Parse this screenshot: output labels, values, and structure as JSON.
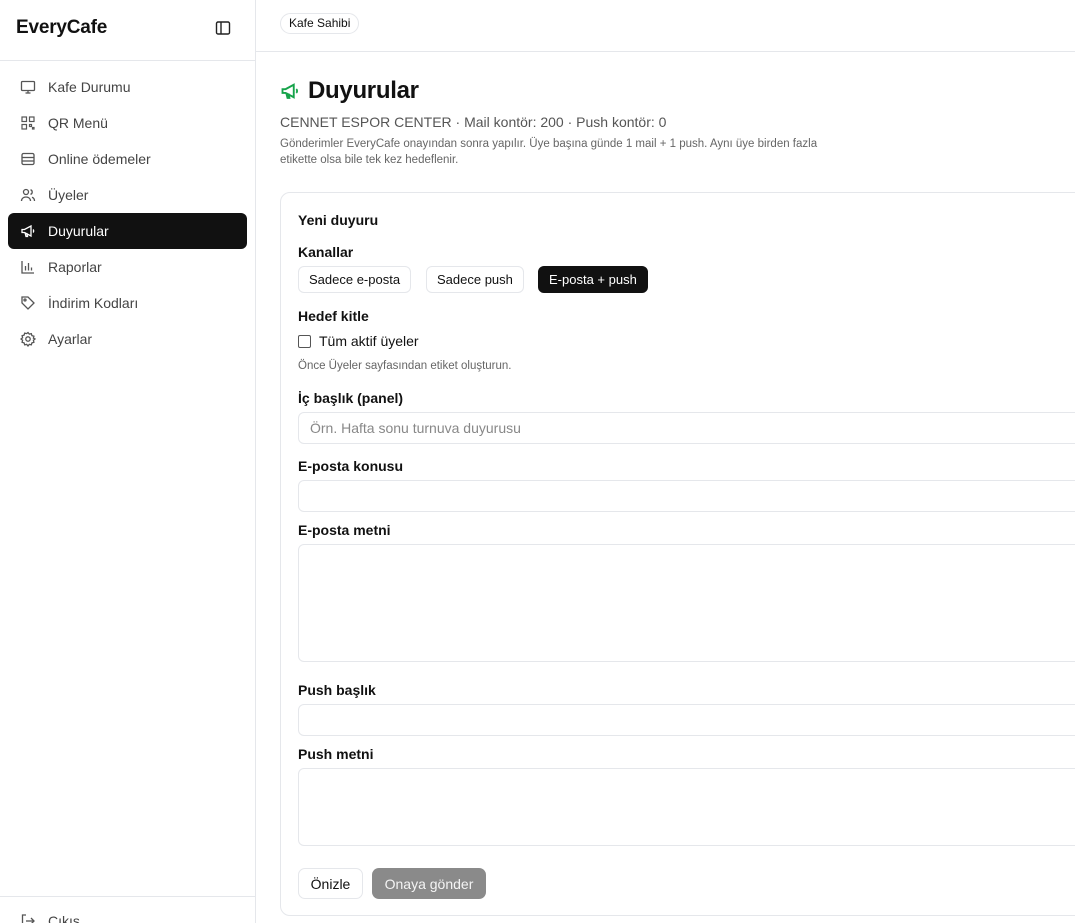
{
  "app": {
    "brand": "EveryCafe"
  },
  "sidebar": {
    "items": [
      {
        "label": "Kafe Durumu",
        "icon": "monitor-icon",
        "active": false
      },
      {
        "label": "QR Menü",
        "icon": "qr-code-icon",
        "active": false
      },
      {
        "label": "Online ödemeler",
        "icon": "database-icon",
        "active": false
      },
      {
        "label": "Üyeler",
        "icon": "users-icon",
        "active": false
      },
      {
        "label": "Duyurular",
        "icon": "megaphone-icon",
        "active": true
      },
      {
        "label": "Raporlar",
        "icon": "bar-chart-icon",
        "active": false
      },
      {
        "label": "İndirim Kodları",
        "icon": "tag-icon",
        "active": false
      },
      {
        "label": "Ayarlar",
        "icon": "gear-icon",
        "active": false
      }
    ],
    "logout_label": "Çıkış"
  },
  "topbar": {
    "role": "Kafe Sahibi"
  },
  "page": {
    "title": "Duyurular",
    "subtitle": "CENNET ESPOR CENTER · Mail kontör: 200 · Push kontör: 0",
    "note": "Gönderimler EveryCafe onayından sonra yapılır. Üye başına günde 1 mail + 1 push. Aynı üye birden fazla etikette olsa bile tek kez hedeflenir."
  },
  "form": {
    "title": "Yeni duyuru",
    "channels_label": "Kanallar",
    "channels": [
      {
        "label": "Sadece e-posta",
        "active": false
      },
      {
        "label": "Sadece push",
        "active": false
      },
      {
        "label": "E-posta + push",
        "active": true
      }
    ],
    "audience_label": "Hedef kitle",
    "all_members_label": "Tüm aktif üyeler",
    "audience_hint": "Önce Üyeler sayfasından etiket oluşturun.",
    "internal_title_label": "İç başlık (panel)",
    "internal_title_placeholder": "Örn. Hafta sonu turnuva duyurusu",
    "email_subject_label": "E-posta konusu",
    "email_body_label": "E-posta metni",
    "push_title_label": "Push başlık",
    "push_body_label": "Push metni",
    "preview_button": "Önizle",
    "submit_button": "Onaya gönder"
  },
  "colors": {
    "accent_green": "#16a34a",
    "active_bg": "#111111",
    "disabled_bg": "#8a8a8a"
  }
}
